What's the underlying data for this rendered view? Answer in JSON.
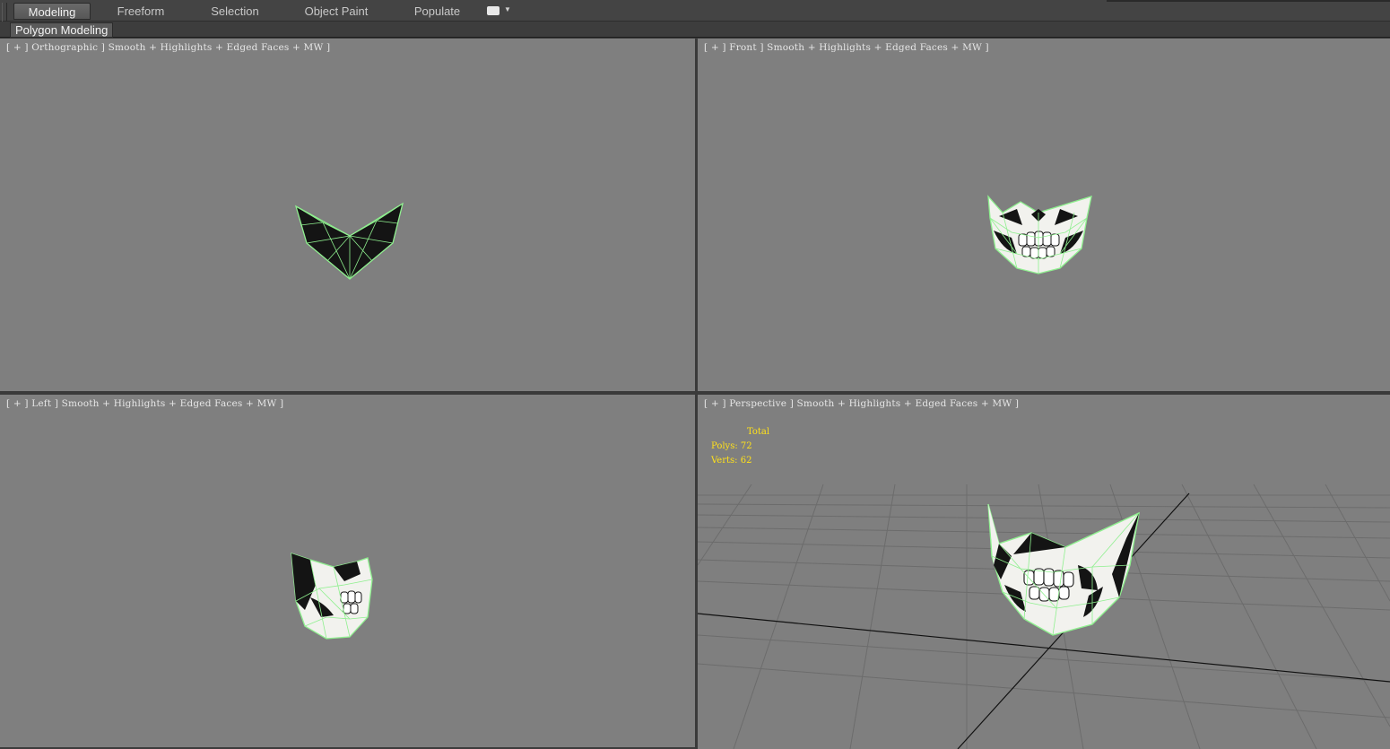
{
  "ribbon": {
    "tabs": [
      {
        "label": "Modeling",
        "active": true
      },
      {
        "label": "Freeform"
      },
      {
        "label": "Selection"
      },
      {
        "label": "Object Paint"
      },
      {
        "label": "Populate"
      }
    ],
    "panel_label": "Polygon Modeling"
  },
  "viewports": {
    "top_left": {
      "label": "[ + ] Orthographic ] Smooth + Highlights + Edged Faces + MW ]"
    },
    "top_right": {
      "label": "[ + ] Front ] Smooth + Highlights + Edged Faces + MW ]"
    },
    "bottom_left": {
      "label": "[ + ] Left ] Smooth + Highlights + Edged Faces + MW ]"
    },
    "bottom_right": {
      "label": "[ + ] Perspective ] Smooth + Highlights + Edged Faces + MW ]",
      "stats": {
        "title": "Total",
        "polys": "Polys: 72",
        "verts": "Verts: 62"
      }
    }
  },
  "colors": {
    "viewport_bg": "#7f7f7f",
    "wireframe": "#8ff08f",
    "stats_text": "#ffe11a",
    "mask_white": "#f2f2ee",
    "mask_dark": "#141414"
  }
}
